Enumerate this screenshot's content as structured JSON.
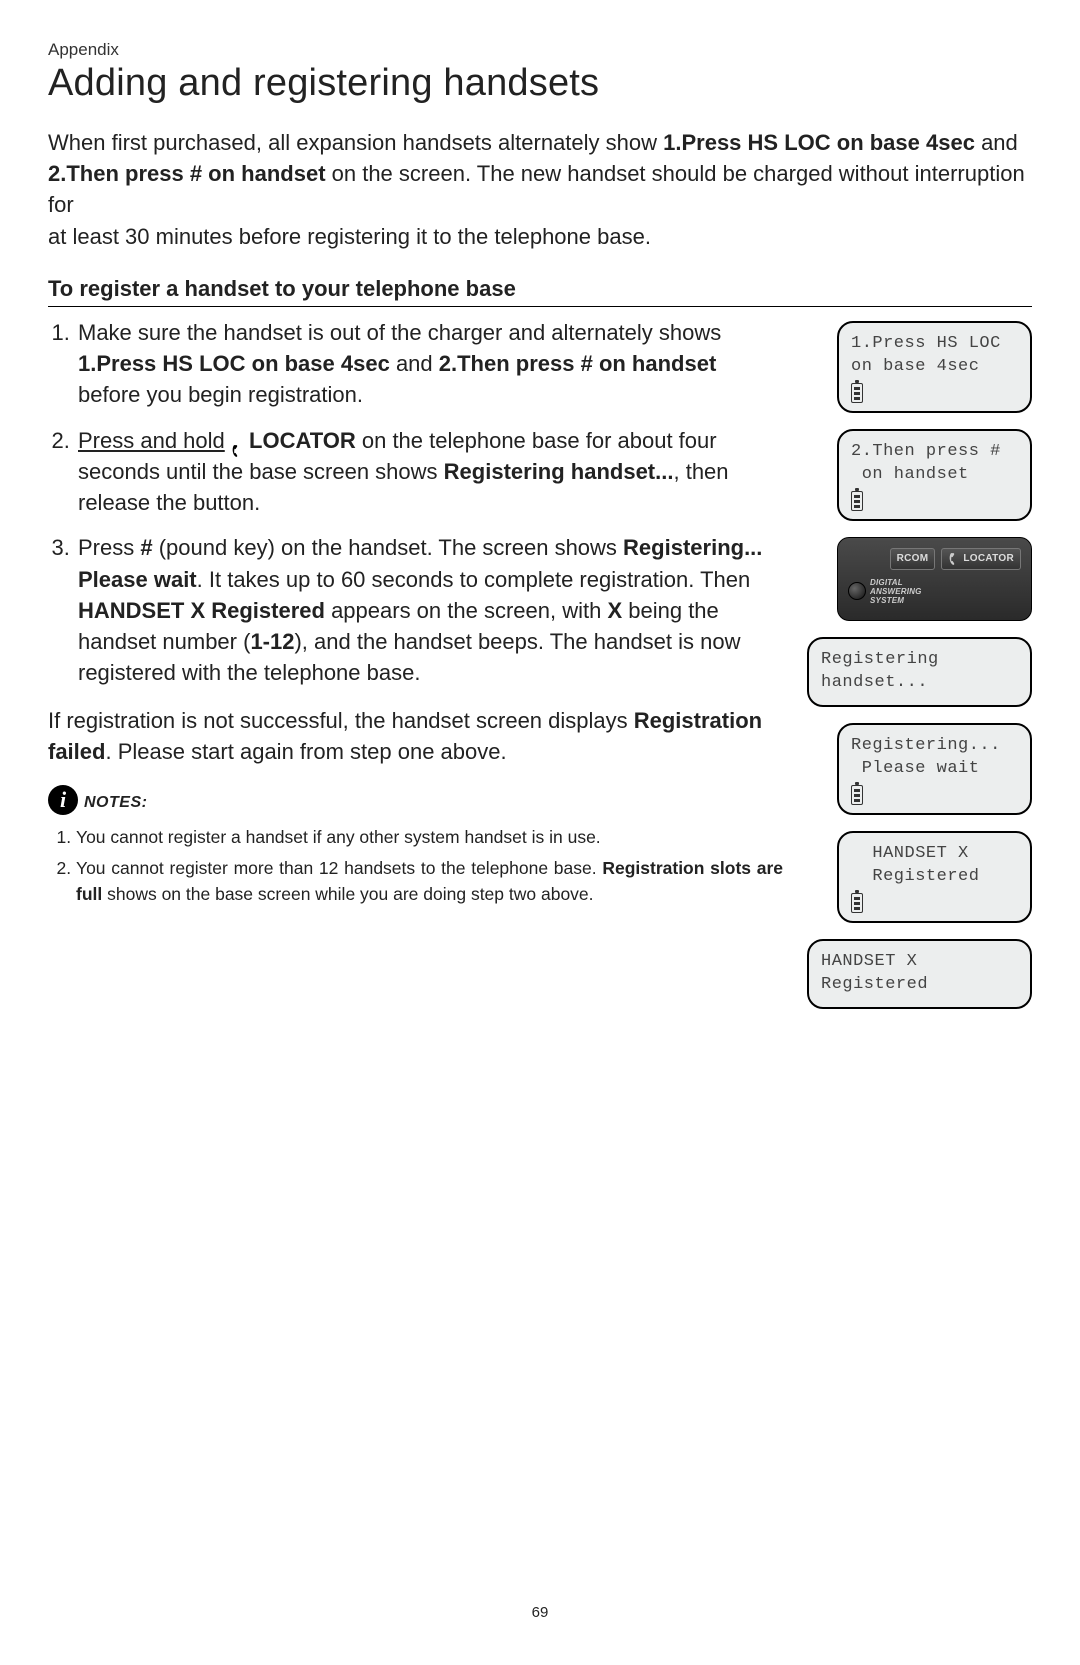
{
  "appendix": "Appendix",
  "title": "Adding and registering handsets",
  "intro": {
    "pre": "When first purchased, all expansion handsets alternately show ",
    "bold1": "1.Press HS LOC on base 4sec",
    "mid1": " and",
    "bold2": "2.Then press # on handset",
    "mid2": " on the screen. The new handset should be charged without interruption for",
    "tail": "at least 30 minutes before registering it to the telephone base."
  },
  "subhead": "To register a handset to your telephone base",
  "steps": {
    "s1": {
      "a": "Make sure the handset is out of the charger and alternately shows ",
      "b1": "1.Press HS LOC on base 4sec",
      "b": " and ",
      "b2": "2.Then press # on handset",
      "c": " before you begin registration."
    },
    "s2": {
      "a": "Press and hold",
      "loc": "LOCATOR",
      "b": " on the telephone base for about four seconds until the base screen shows ",
      "b1": "Registering handset...",
      "c": ", then release the button."
    },
    "s3": {
      "a": "Press ",
      "pound": "#",
      "b": " (pound key) on the handset. The screen shows ",
      "b1": "Registering... Please wait",
      "c": ". It takes up to 60 seconds to complete registration. Then ",
      "b2": "HANDSET X Registered",
      "d": " appears on the screen, with ",
      "b3": "X",
      "e": " being the handset number (",
      "b4": "1-12",
      "f": "), and the handset beeps. The handset is now registered with the telephone base."
    }
  },
  "failpara": {
    "a": "If registration is not successful, the handset screen displays ",
    "b1": "Registration failed",
    "b": ". Please start again from step one above."
  },
  "notes_label": "NOTES:",
  "notes": {
    "n1": "You cannot register a handset if any other system handset is in use.",
    "n2a": "You cannot register more than 12 handsets to the telephone base. ",
    "n2b": "Registration slots are full",
    "n2c": " shows on the base screen while you are doing step two above."
  },
  "screens": {
    "s1l1": "1.Press HS LOC",
    "s1l2": "on base 4sec",
    "s2l1": "2.Then press #",
    "s2l2": " on handset",
    "base_rcom": "RCOM",
    "base_loc": "LOCATOR",
    "base_das": "DIGITAL\nANSWERING\nSYSTEM",
    "s3l1": "Registering",
    "s3l2": "handset...",
    "s4l1": "Registering...",
    "s4l2": " Please wait",
    "s5l1": "  HANDSET X",
    "s5l2": "  Registered",
    "s6l1": "HANDSET X",
    "s6l2": "Registered"
  },
  "page_number": "69"
}
